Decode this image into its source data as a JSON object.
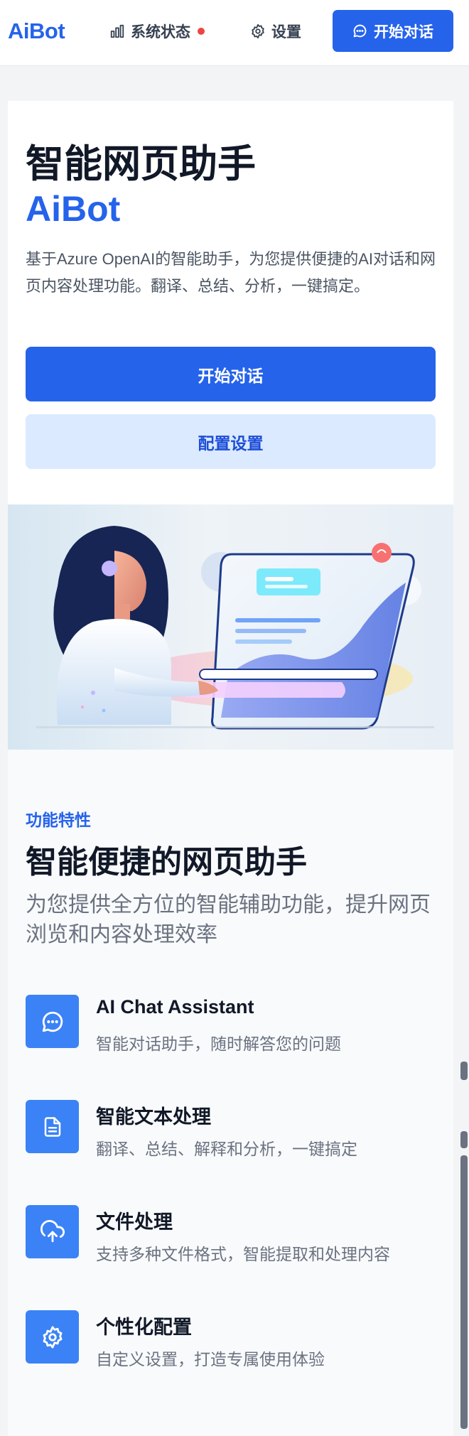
{
  "header": {
    "logo": "AiBot",
    "status_label": "系统状态",
    "settings_label": "设置",
    "cta_label": "开始对话",
    "status_dot_color": "#ef4444"
  },
  "hero": {
    "title": "智能网页助手",
    "brand": "AiBot",
    "description": "基于Azure OpenAI的智能助手，为您提供便捷的AI对话和网页内容处理功能。翻译、总结、分析，一键搞定。",
    "primary_button": "开始对话",
    "secondary_button": "配置设置"
  },
  "illustration": {
    "name": "ai-assistant-illustration"
  },
  "features": {
    "eyebrow": "功能特性",
    "title": "智能便捷的网页助手",
    "subtitle": "为您提供全方位的智能辅助功能，提升网页浏览和内容处理效率",
    "items": [
      {
        "icon": "chat-icon",
        "name": "AI Chat Assistant",
        "desc": "智能对话助手，随时解答您的问题"
      },
      {
        "icon": "document-icon",
        "name": "智能文本处理",
        "desc": "翻译、总结、解释和分析，一键搞定"
      },
      {
        "icon": "upload-cloud-icon",
        "name": "文件处理",
        "desc": "支持多种文件格式，智能提取和处理内容"
      },
      {
        "icon": "gear-icon",
        "name": "个性化配置",
        "desc": "自定义设置，打造专属使用体验"
      }
    ]
  },
  "colors": {
    "accent": "#2563eb",
    "accent_light": "#dbeafe",
    "icon_bg": "#3b82f6"
  }
}
